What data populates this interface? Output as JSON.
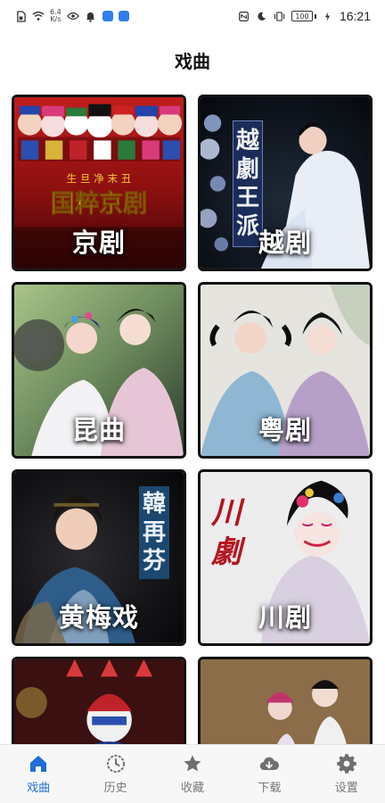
{
  "status_bar": {
    "net_speed_value": "6.4",
    "net_speed_unit": "K/s",
    "battery": "100",
    "time": "16:21"
  },
  "header": {
    "title": "戏曲"
  },
  "cards": [
    {
      "label": "京剧",
      "art_text": "国粹京剧",
      "art_sub": "生 旦 净 末 丑"
    },
    {
      "label": "越剧",
      "banner": [
        "越",
        "劇",
        "王",
        "派"
      ]
    },
    {
      "label": "昆曲"
    },
    {
      "label": "粤剧"
    },
    {
      "label": "黄梅戏",
      "banner": [
        "韓",
        "再",
        "芬"
      ]
    },
    {
      "label": "川剧",
      "art_text": [
        "川",
        "劇"
      ]
    },
    {
      "label": ""
    },
    {
      "label": ""
    }
  ],
  "tabbar": {
    "items": [
      {
        "label": "戏曲",
        "icon": "home-icon",
        "active": true
      },
      {
        "label": "历史",
        "icon": "history-icon",
        "active": false
      },
      {
        "label": "收藏",
        "icon": "star-icon",
        "active": false
      },
      {
        "label": "下载",
        "icon": "cloud-download-icon",
        "active": false
      },
      {
        "label": "设置",
        "icon": "gear-icon",
        "active": false
      }
    ]
  },
  "colors": {
    "accent": "#1e6fd9",
    "tab_inactive": "#777777",
    "card_border": "#111111"
  }
}
